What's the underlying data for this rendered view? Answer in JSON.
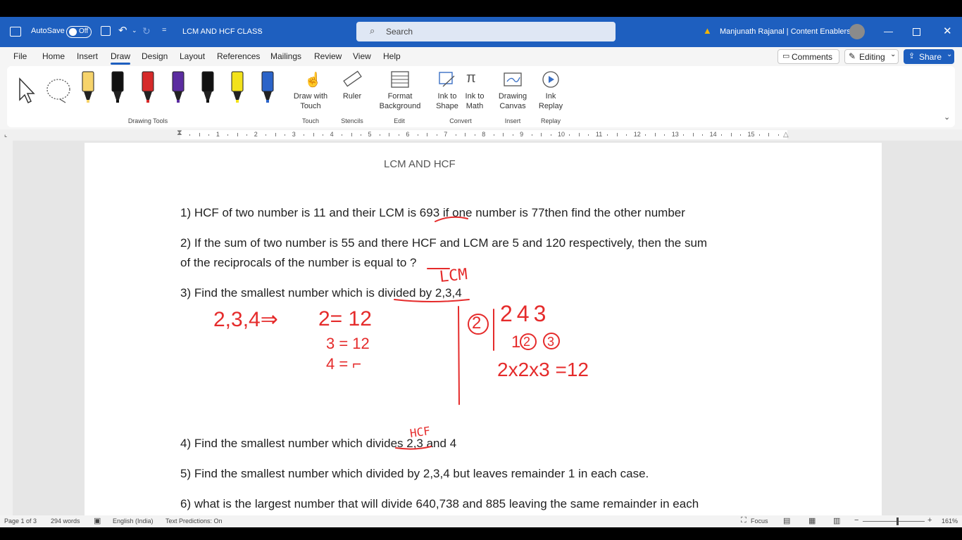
{
  "titlebar": {
    "autosave_label": "AutoSave",
    "autosave_state": "Off",
    "doc_title": "LCM AND HCF CLASS",
    "search_placeholder": "Search",
    "user": "Manjunath Rajanal | Content Enablers"
  },
  "menu": {
    "tabs": [
      "File",
      "Home",
      "Insert",
      "Draw",
      "Design",
      "Layout",
      "References",
      "Mailings",
      "Review",
      "View",
      "Help"
    ],
    "active": "Draw",
    "comments_label": "Comments",
    "editing_label": "Editing",
    "share_label": "Share"
  },
  "ribbon": {
    "groups": {
      "drawing_tools": "Drawing Tools",
      "touch": "Touch",
      "stencils": "Stencils",
      "edit": "Edit",
      "convert": "Convert",
      "insert": "Insert",
      "replay": "Replay"
    },
    "buttons": {
      "draw_with_touch": [
        "Draw with",
        "Touch"
      ],
      "ruler": "Ruler",
      "format_background": [
        "Format",
        "Background"
      ],
      "ink_to_shape": [
        "Ink to",
        "Shape"
      ],
      "ink_to_math": [
        "Ink to",
        "Math"
      ],
      "drawing_canvas": [
        "Drawing",
        "Canvas"
      ],
      "ink_replay": [
        "Ink",
        "Replay"
      ]
    },
    "pen_colors": [
      "#f6d36b",
      "#111111",
      "#d62a2a",
      "#5b2ca0",
      "#111111",
      "#f3e21b",
      "#2b63c8"
    ]
  },
  "ruler_numbers": [
    "1",
    "2",
    "3",
    "4",
    "5",
    "6",
    "7",
    "8",
    "9",
    "10",
    "11",
    "12",
    "13",
    "14",
    "15"
  ],
  "document": {
    "title": "LCM AND HCF",
    "q1": "1) HCF of two number is 11 and their LCM is 693 if one number is 77then find the other number",
    "q2a": "2) If the sum of two number is 55 and there HCF and LCM are 5 and 120 respectively, then the sum",
    "q2b": "of the reciprocals of the number is equal to ?",
    "q3": "3) Find the smallest number which is divided by 2,3,4",
    "q4": "4) Find the smallest number which divides 2,3 and 4",
    "q5": "5) Find the smallest number which divided by 2,3,4 but leaves remainder 1 in each case.",
    "q6": "6) what is the largest number that will divide 640,738 and 885 leaving the same remainder in each"
  },
  "ink": {
    "color": "#e52b2b",
    "lcm": "LCM",
    "hcf": "HCF",
    "left_expr": "2,3,4⇒",
    "eq1": "2= 12",
    "eq2": "3 = 12",
    "eq3": "4 = ⌐",
    "circled_two": "2",
    "row1": "243",
    "row2_1": "1",
    "row2_2": "2",
    "row2_3": "3",
    "product": "2x2x3 =12"
  },
  "status": {
    "page": "Page 1 of 3",
    "words": "294 words",
    "language": "English (India)",
    "predictions": "Text Predictions: On",
    "focus": "Focus",
    "zoom": "161%"
  }
}
